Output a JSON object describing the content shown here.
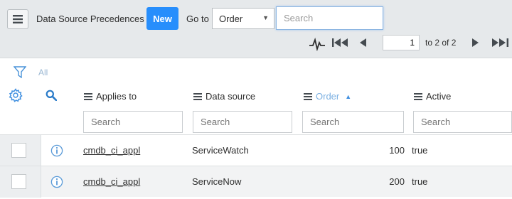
{
  "header": {
    "title": "Data Source Precedences",
    "new_label": "New",
    "goto_label": "Go to",
    "goto_field": "Order",
    "search_placeholder": "Search"
  },
  "pager": {
    "current_page": "1",
    "range_text": "to 2 of 2"
  },
  "filter": {
    "all_label": "All"
  },
  "columns": [
    {
      "label": "Applies to",
      "sorted": false
    },
    {
      "label": "Data source",
      "sorted": false
    },
    {
      "label": "Order",
      "sorted": true,
      "sort_direction": "ascending"
    },
    {
      "label": "Active",
      "sorted": false
    }
  ],
  "column_search_placeholder": "Search",
  "rows": [
    {
      "applies_to": "cmdb_ci_appl",
      "data_source": "ServiceWatch",
      "order": "100",
      "active": "true"
    },
    {
      "applies_to": "cmdb_ci_appl",
      "data_source": "ServiceNow",
      "order": "200",
      "active": "true"
    }
  ],
  "colors": {
    "primary_button": "#278efc",
    "header_bg": "#e6e9eb",
    "accent_icon": "#3f8fe0"
  },
  "icons": [
    "menu-icon",
    "activity-icon",
    "first-page-icon",
    "previous-page-icon",
    "next-page-icon",
    "last-page-icon",
    "filter-icon",
    "gear-icon",
    "search-icon",
    "info-icon"
  ]
}
